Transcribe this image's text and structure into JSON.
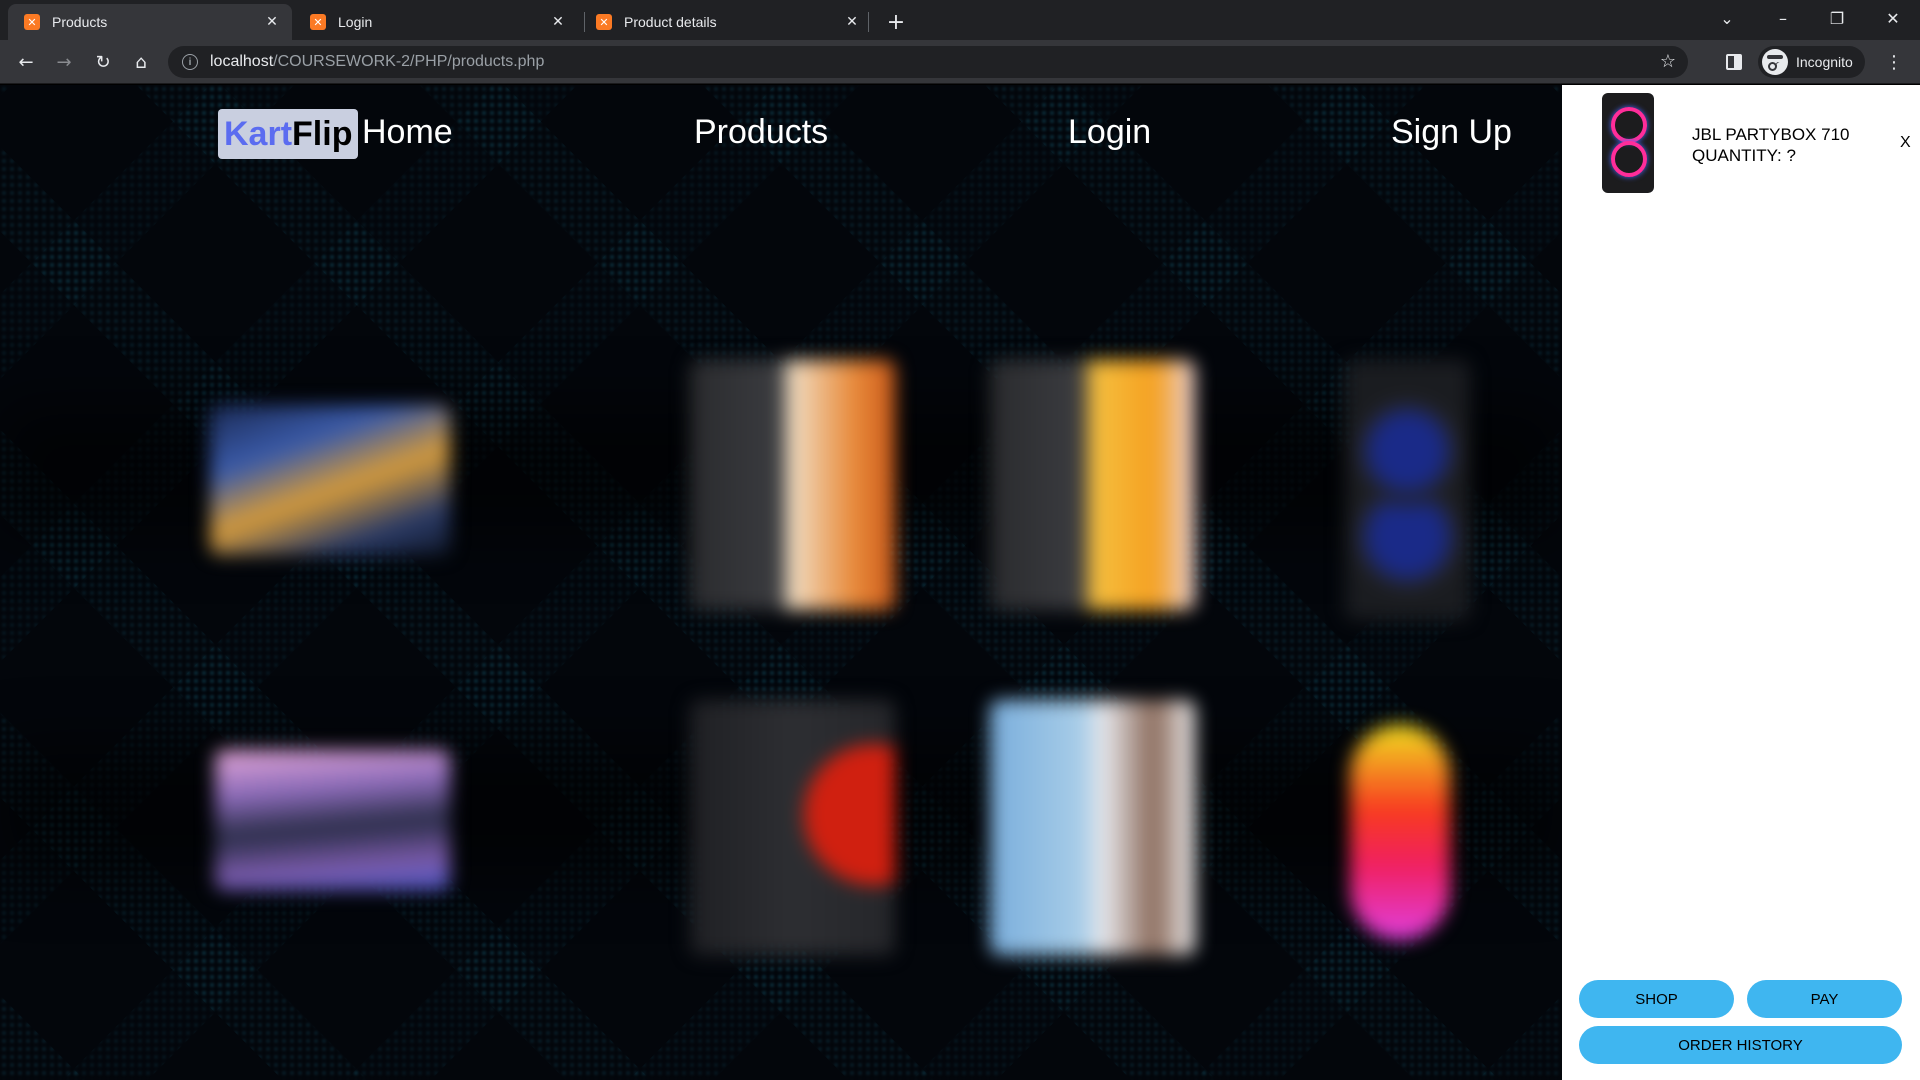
{
  "browser": {
    "tabs": [
      {
        "title": "Products",
        "active": true
      },
      {
        "title": "Login",
        "active": false
      },
      {
        "title": "Product details",
        "active": false
      }
    ],
    "new_tab": "+",
    "url_host": "localhost",
    "url_path": "/COURSEWORK-2/PHP/products.php",
    "profile_label": "Incognito",
    "icons": {
      "tab_favicon": "xampp-icon",
      "back": "←",
      "forward": "→",
      "reload": "↻",
      "home": "⌂",
      "bookmark": "☆",
      "menu": "⋮",
      "close_tab": "✕",
      "minimize": "–",
      "restore": "❐",
      "close_window": "✕",
      "tab_search": "⌄"
    }
  },
  "site": {
    "logo_part1": "Kart",
    "logo_part2": "Flip",
    "nav": [
      "Home",
      "Products",
      "Login",
      "Sign Up"
    ],
    "colors": {
      "logo_bg": "#c9cfe0",
      "logo_accent": "#5b6cf0",
      "page_bg": "#03060b",
      "pattern": "#28aad2"
    }
  },
  "cart": {
    "item": {
      "name": "JBL PARTYBOX 710",
      "quantity_label": "QUANTITY: ?"
    },
    "close_label": "X",
    "buttons": {
      "shop": "SHOP",
      "pay": "PAY",
      "order_history": "ORDER HISTORY"
    },
    "colors": {
      "button_bg": "#3fb6f0",
      "panel_bg": "#ffffff"
    }
  }
}
